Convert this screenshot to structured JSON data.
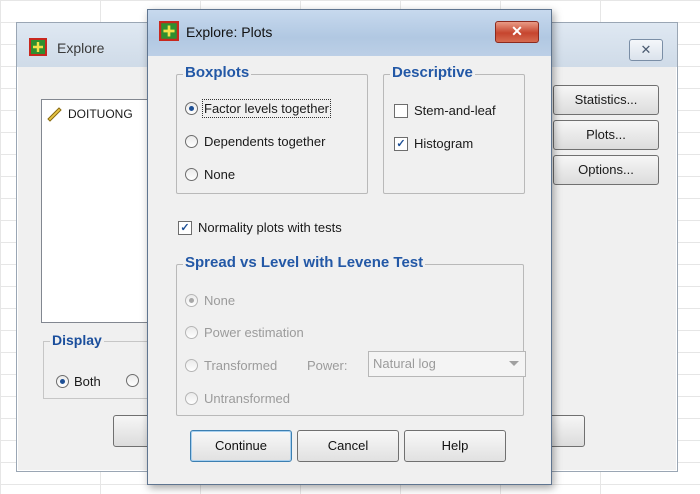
{
  "background_window": {
    "title": "Explore",
    "close_glyph": "✕",
    "variable": "DOITUONG",
    "buttons": {
      "statistics": "Statistics...",
      "plots": "Plots...",
      "options": "Options..."
    },
    "display": {
      "legend": "Display",
      "both": "Both"
    }
  },
  "dialog": {
    "title": "Explore: Plots",
    "close_glyph": "✕",
    "boxplots": {
      "legend": "Boxplots",
      "options": [
        "Factor levels together",
        "Dependents together",
        "None"
      ],
      "selected": "Factor levels together"
    },
    "descriptive": {
      "legend": "Descriptive",
      "stem_and_leaf": {
        "label": "Stem-and-leaf",
        "checked": false
      },
      "histogram": {
        "label": "Histogram",
        "checked": true
      }
    },
    "normality": {
      "label": "Normality plots with tests",
      "checked": true
    },
    "spread": {
      "legend": "Spread vs Level with Levene Test",
      "options": [
        "None",
        "Power estimation",
        "Transformed",
        "Untransformed"
      ],
      "selected": "None",
      "power_label": "Power:",
      "power_value": "Natural log"
    },
    "buttons": {
      "continue": "Continue",
      "cancel": "Cancel",
      "help": "Help"
    }
  },
  "colors": {
    "legend": "#2358a6",
    "close_button": "#c6452e",
    "titlebar": "#b1c8e2"
  }
}
